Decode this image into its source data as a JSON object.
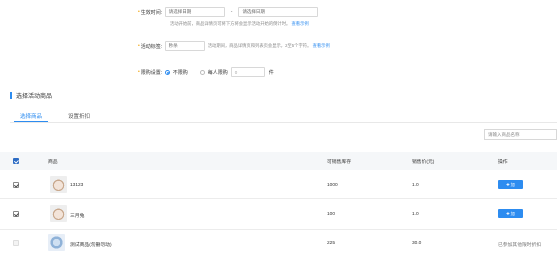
{
  "form": {
    "time": {
      "label": "生效时间:",
      "start_placeholder": "请选择日期",
      "sep": "-",
      "end_placeholder": "请选择日期",
      "helper": "活动开始前，商品详情页可将下方将会显示活动开始的倒计时。",
      "helper_link": "查看示例"
    },
    "tag": {
      "label": "活动标签:",
      "value": "秒杀",
      "helper": "活动期间，商品详情页和列表页会显示，2至5个字符。",
      "helper_link": "查看示例"
    },
    "limit": {
      "label": "限购设置:",
      "opt1": "不限购",
      "opt2": "每人限购",
      "qty": "0",
      "unit": "件"
    }
  },
  "section_title": "选择活动商品",
  "tabs": [
    "选择商品",
    "设置折扣"
  ],
  "search_placeholder": "请输入商品名称",
  "table": {
    "headers": [
      "商品",
      "可销售库存",
      "销售价(元)",
      "操作"
    ],
    "rows": [
      {
        "name": "13123",
        "stock": "1000",
        "price": "1.0",
        "action": "加"
      },
      {
        "name": "三月兔",
        "stock": "100",
        "price": "1.0",
        "action": "加"
      },
      {
        "name": "测试商品(勿删勿动)",
        "stock": "225",
        "price": "30.0",
        "action": "已参加其他限时折扣"
      }
    ]
  },
  "colors": {
    "accent": "#2d8cf0",
    "required": "#f0a000"
  },
  "icons": {
    "add": "plus-icon"
  }
}
